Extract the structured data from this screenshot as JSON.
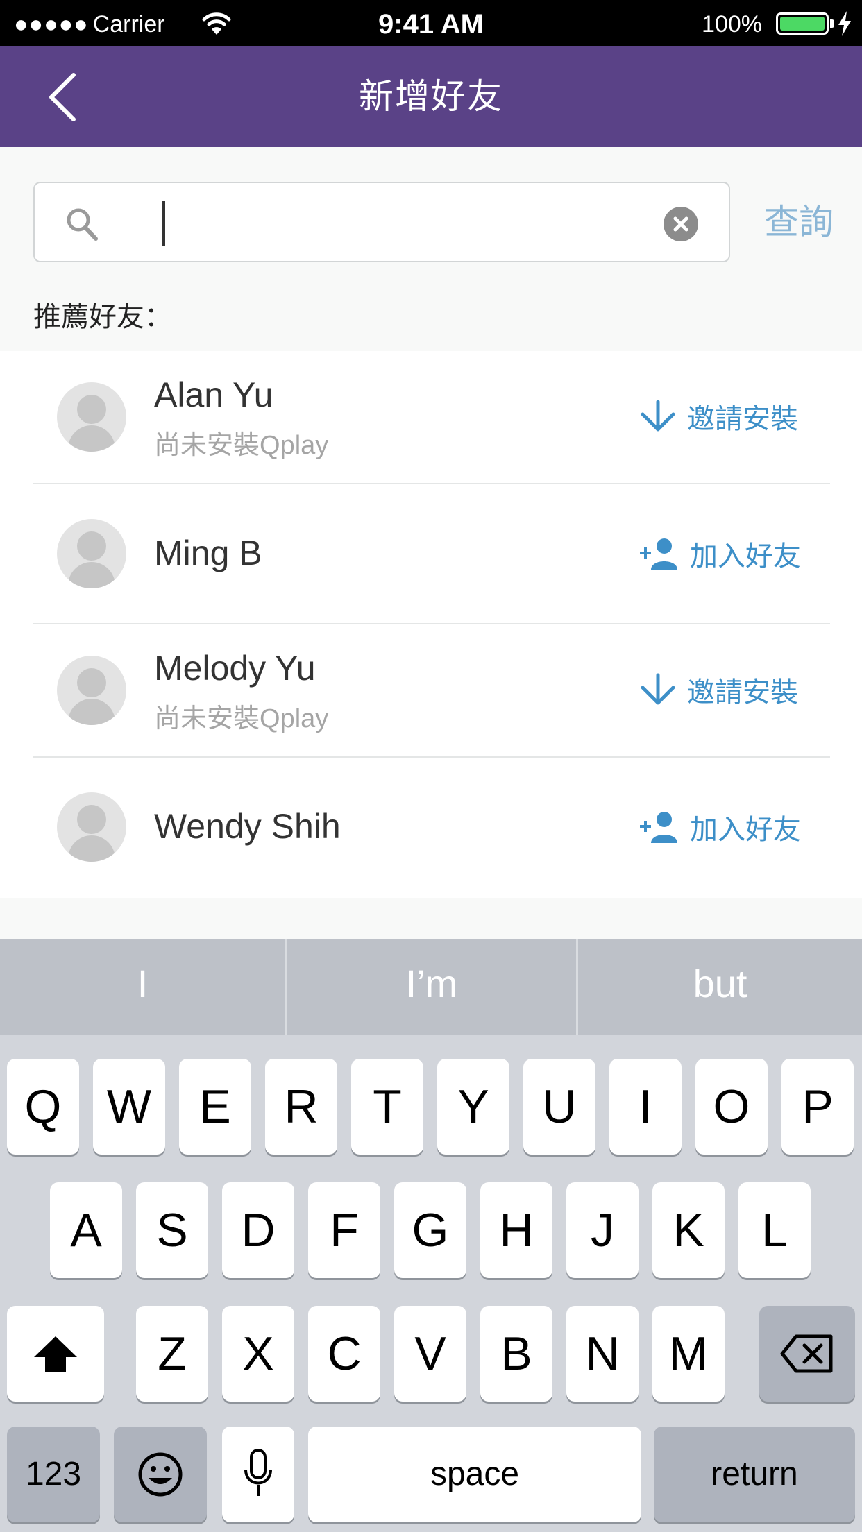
{
  "status_bar": {
    "carrier": "Carrier",
    "time": "9:41 AM",
    "battery": "100%"
  },
  "nav": {
    "title": "新增好友"
  },
  "search": {
    "placeholder": "",
    "value": "",
    "button": "查詢"
  },
  "section_label": "推薦好友：",
  "friends": [
    {
      "name": "Alan Yu",
      "status": "尚未安裝Qplay",
      "action": "邀請安裝",
      "action_icon": "download-arrow-icon"
    },
    {
      "name": "Ming B",
      "status": "",
      "action": "加入好友",
      "action_icon": "add-user-icon"
    },
    {
      "name": "Melody Yu",
      "status": "尚未安裝Qplay",
      "action": "邀請安裝",
      "action_icon": "download-arrow-icon"
    },
    {
      "name": "Wendy Shih",
      "status": "",
      "action": "加入好友",
      "action_icon": "add-user-icon"
    }
  ],
  "keyboard": {
    "suggestions": [
      "I",
      "I’m",
      "but"
    ],
    "row1": [
      "Q",
      "W",
      "E",
      "R",
      "T",
      "Y",
      "U",
      "I",
      "O",
      "P"
    ],
    "row2": [
      "A",
      "S",
      "D",
      "F",
      "G",
      "H",
      "J",
      "K",
      "L"
    ],
    "row3": [
      "Z",
      "X",
      "C",
      "V",
      "B",
      "N",
      "M"
    ],
    "numbers": "123",
    "space": "space",
    "return": "return"
  },
  "colors": {
    "nav": "#5a4287",
    "accent": "#3d8fc8",
    "battery": "#4cd964"
  }
}
